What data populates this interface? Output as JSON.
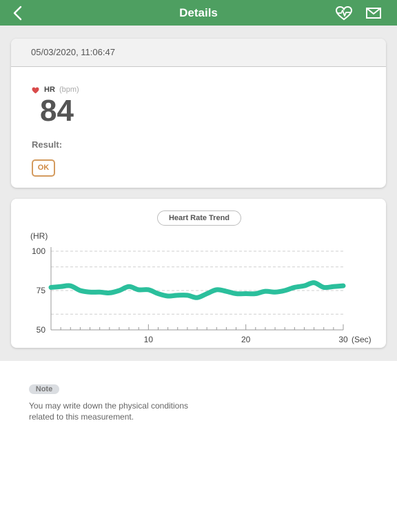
{
  "header": {
    "title": "Details",
    "back_icon": "chevron-left-icon",
    "heart_rate_icon": "heart-pulse-icon",
    "mail_icon": "mail-icon",
    "bg_color": "#4e9f61"
  },
  "measurement": {
    "datetime": "05/03/2020, 11:06:47",
    "hr_label": "HR",
    "unit": "(bpm)",
    "value": "84",
    "result_label": "Result:",
    "result": "OK",
    "result_color": "#d08a44"
  },
  "trend": {
    "title": "Heart Rate Trend"
  },
  "chart_data": {
    "type": "line",
    "title": "Heart Rate Trend",
    "ylabel": "(HR)",
    "xunit": "(Sec)",
    "ylim": [
      50,
      100
    ],
    "xlim": [
      0,
      30
    ],
    "yticks": [
      "100",
      "75",
      "50"
    ],
    "xticks": [
      "10",
      "20",
      "30"
    ],
    "grid": true,
    "line_color": "#2bbf9c",
    "series": [
      {
        "x": [
          0,
          1,
          2,
          3,
          4,
          5,
          6,
          7,
          8,
          9,
          10,
          11,
          12,
          13,
          14,
          15,
          16,
          17,
          18,
          19,
          20,
          21,
          22,
          23,
          24,
          25,
          26,
          27,
          28,
          29,
          30
        ],
        "values": [
          77,
          77.5,
          78,
          75,
          74,
          74,
          73.5,
          75,
          77.5,
          75.5,
          75.5,
          73,
          71.5,
          72,
          72,
          70.5,
          73,
          75.5,
          74.5,
          73,
          73,
          73,
          74.5,
          74,
          75,
          77,
          78,
          80,
          77,
          77.5,
          78
        ]
      }
    ]
  },
  "note": {
    "badge": "Note",
    "line1": "You may write down the physical conditions",
    "line2": "related to this measurement."
  }
}
